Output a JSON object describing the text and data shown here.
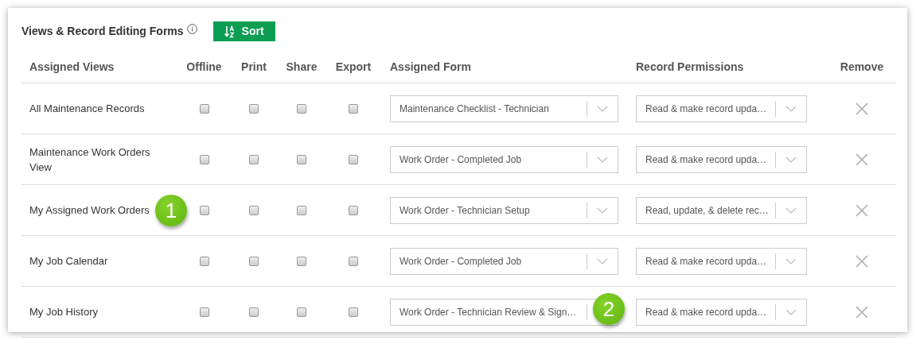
{
  "title": "Views & Record Editing Forms",
  "sort_button": {
    "label": "Sort"
  },
  "columns": [
    "Assigned Views",
    "Offline",
    "Print",
    "Share",
    "Export",
    "Assigned Form",
    "Record Permissions",
    "Remove"
  ],
  "rows": [
    {
      "view": "All Maintenance Records",
      "offline": false,
      "print": false,
      "share": false,
      "export": false,
      "form": "Maintenance Checklist - Technician",
      "permission": "Read & make record upda…"
    },
    {
      "view": "Maintenance Work Orders View",
      "offline": false,
      "print": false,
      "share": false,
      "export": false,
      "form": "Work Order - Completed Job",
      "permission": "Read & make record upda…"
    },
    {
      "view": "My Assigned Work Orders",
      "offline": false,
      "print": false,
      "share": false,
      "export": false,
      "form": "Work Order - Technician Setup",
      "permission": "Read, update, & delete rec…",
      "view_callout": {
        "label": "1"
      }
    },
    {
      "view": "My Job Calendar",
      "offline": false,
      "print": false,
      "share": false,
      "export": false,
      "form": "Work Order - Completed Job",
      "permission": "Read & make record upda…"
    },
    {
      "view": "My Job History",
      "offline": false,
      "print": false,
      "share": false,
      "export": false,
      "form": "Work Order - Technician Review & Sign…",
      "permission": "Read & make record upda…",
      "form_callout": {
        "label": "2"
      }
    }
  ]
}
